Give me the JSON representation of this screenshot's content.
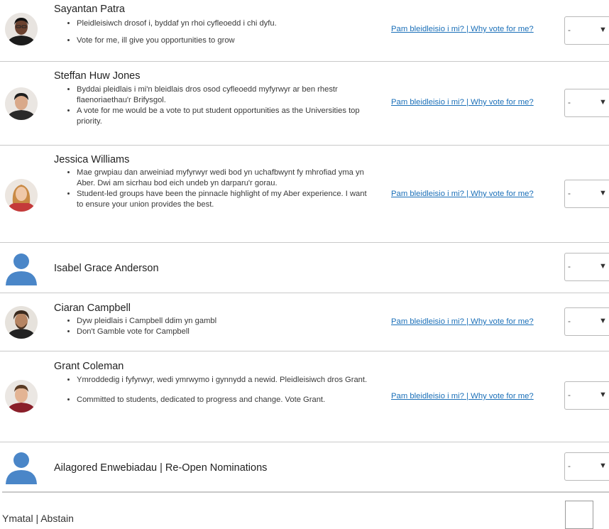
{
  "link_text": "Pam bleidleisio i mi? | Why vote for me?",
  "candidates": [
    {
      "name": "Sayantan Patra",
      "statements": [
        "Pleidleisiwch drosof i, byddaf yn rhoi cyfleoedd i chi dyfu.",
        "Vote for me, ill give you opportunities to grow"
      ],
      "preference": "-"
    },
    {
      "name": "Steffan Huw Jones",
      "statements": [
        "Byddai pleidlais i mi'n bleidlais dros osod cyfleoedd myfyrwyr ar ben rhestr flaenoriaethau'r Brifysgol.",
        "A vote for me would be a vote to put student opportunities as the Universities top priority."
      ],
      "preference": "-"
    },
    {
      "name": "Jessica Williams",
      "statements": [
        "Mae grwpiau dan arweiniad myfyrwyr wedi bod yn uchafbwynt fy mhrofiad yma yn Aber.  Dwi am sicrhau bod eich undeb yn darparu'r gorau.",
        "Student-led groups have been the pinnacle highlight of my Aber experience.  I want to ensure your union provides the best."
      ],
      "preference": "-"
    },
    {
      "name": "Isabel Grace Anderson",
      "statements": [],
      "preference": "-"
    },
    {
      "name": "Ciaran Campbell",
      "statements": [
        "Dyw pleidlais i Campbell ddim yn gambl",
        "Don't Gamble vote for Campbell"
      ],
      "preference": "-"
    },
    {
      "name": "Grant Coleman",
      "statements": [
        "Ymroddedig i fyfyrwyr, wedi ymrwymo i gynnydd a newid. Pleidleisiwch dros Grant.",
        "Committed to students, dedicated to progress and change. Vote Grant."
      ],
      "preference": "-"
    },
    {
      "name": "Ailagored Enwebiadau | Re-Open Nominations",
      "statements": [],
      "preference": "-"
    }
  ],
  "abstain": {
    "label": "Ymatal | Abstain",
    "checked": false
  },
  "dropdown_arrow": "▼",
  "colors": {
    "link": "#1a6fb8",
    "generic_avatar": "#4a86c8",
    "divider": "#c9c9c9"
  },
  "icons": {
    "generic_avatar": "person-silhouette-icon",
    "dropdown": "caret-down-icon"
  }
}
